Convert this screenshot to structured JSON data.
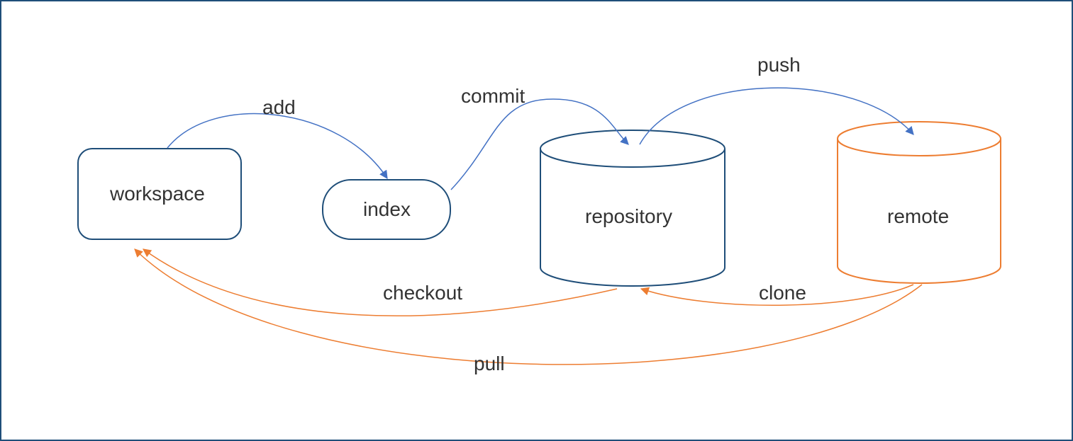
{
  "nodes": {
    "workspace": {
      "label": "workspace"
    },
    "index": {
      "label": "index"
    },
    "repository": {
      "label": "repository"
    },
    "remote": {
      "label": "remote"
    }
  },
  "edges": {
    "add": {
      "label": "add"
    },
    "commit": {
      "label": "commit"
    },
    "push": {
      "label": "push"
    },
    "checkout": {
      "label": "checkout"
    },
    "clone": {
      "label": "clone"
    },
    "pull": {
      "label": "pull"
    }
  },
  "colors": {
    "navy": "#1f4e79",
    "blueStroke": "#4472c4",
    "orange": "#ed7d31"
  }
}
